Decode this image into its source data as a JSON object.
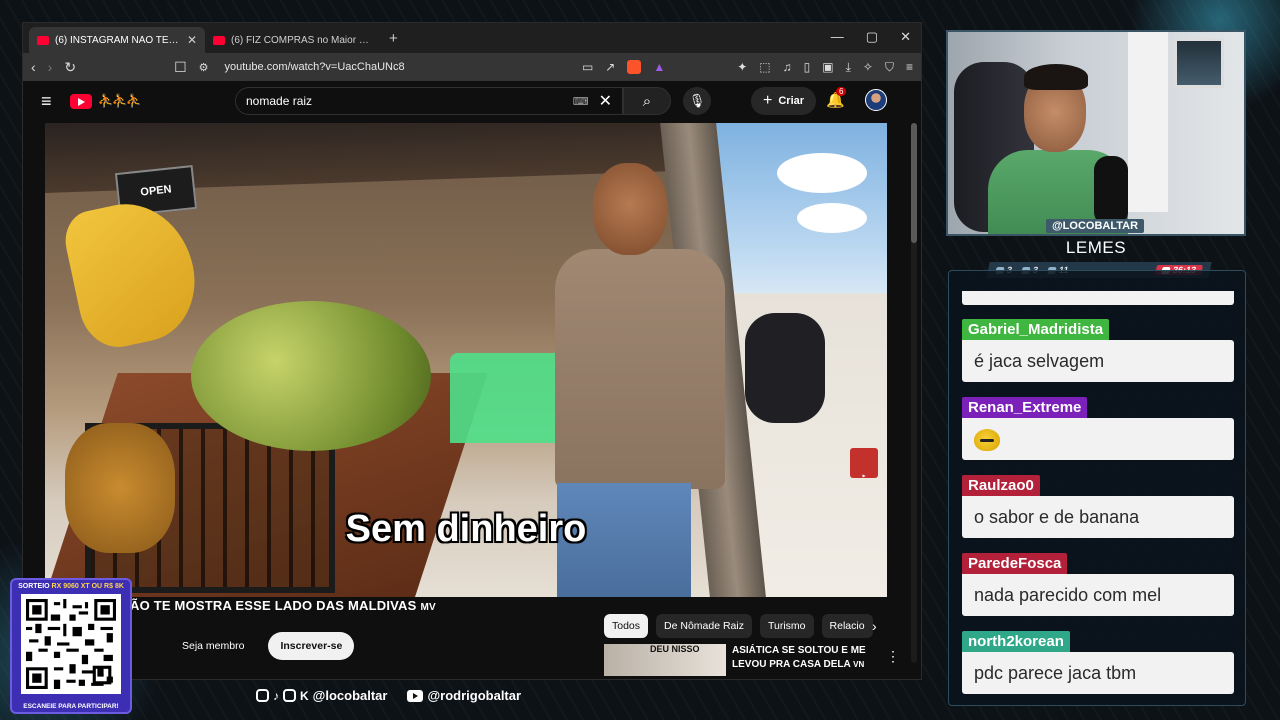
{
  "browser": {
    "tabs": [
      {
        "title": "(6) INSTAGRAM NÃO TE MOSTRA E",
        "close": "✕"
      },
      {
        "title": "(6) FIZ COMPRAS no Maior Shopping da Ch"
      }
    ],
    "new_tab": "+",
    "window_controls": {
      "minimize": "—",
      "maximize": "▢",
      "close": "✕"
    },
    "url": "youtube.com/watch?v=UacChaUNc8"
  },
  "youtube": {
    "search_value": "nomade raiz",
    "create_label": "Criar",
    "notification_count": "6",
    "video": {
      "subtitle": "Sem dinheiro",
      "open_sign": "OPEN",
      "title": "ÃO TE MOSTRA ESSE LADO DAS MALDIVAS",
      "title_suffix": "MV",
      "member_button": "Seja membro",
      "subscribe_button": "Inscrever-se"
    },
    "chips": [
      "Todos",
      "De Nômade Raiz",
      "Turismo",
      "Relacio"
    ],
    "recommendation": {
      "thumb_text": "DEU NISSO",
      "title": "ASIÁTICA SE SOLTOU E ME LEVOU PRA CASA DELA",
      "suffix": "VN"
    }
  },
  "stream": {
    "handle": "@LOCOBALTAR",
    "name": "LEMES",
    "stats": [
      "3",
      "3",
      "11"
    ],
    "timer": "36:13",
    "accent": "#d8344a"
  },
  "chat": [
    {
      "user": "Gabriel_Madridista",
      "color": "#3fb63f",
      "text": "é jaca selvagem"
    },
    {
      "user": "Renan_Extreme",
      "color": "#7b20b8",
      "text": "",
      "emoji": true
    },
    {
      "user": "Raulzao0",
      "color": "#b3203a",
      "text": "o sabor e de banana"
    },
    {
      "user": "ParedeFosca",
      "color": "#b3203a",
      "text": "nada parecido com mel"
    },
    {
      "user": "north2korean",
      "color": "#2fa88a",
      "text": "pdc parece jaca tbm"
    }
  ],
  "sorteio": {
    "top_prefix": "SORTEIO ",
    "top_highlight": "RX 9060 XT OU R$ 8K",
    "bottom": "ESCANEIE PARA PARTICIPAR!"
  },
  "socials": {
    "handle1": "@locobaltar",
    "handle2": "@rodrigobaltar"
  }
}
